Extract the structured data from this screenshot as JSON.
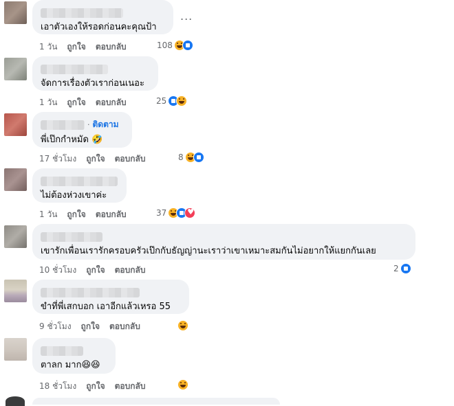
{
  "comments": [
    {
      "text": "เอาตัวเองให้รอดก่อนคะคุณป้า",
      "time": "1 วัน",
      "like_label": "ถูกใจ",
      "reply_label": "ตอบกลับ",
      "reaction_count": "108",
      "reactions": [
        "haha-icon",
        "like-icon"
      ],
      "more": "..."
    },
    {
      "text": "จัดการเรื่องตัวเราก่อนเนอะ",
      "time": "1 วัน",
      "like_label": "ถูกใจ",
      "reply_label": "ตอบกลับ",
      "reaction_count": "25",
      "reactions": [
        "like-icon",
        "haha-icon"
      ]
    },
    {
      "text": "พี่เป๊กกำหมัด 🤣",
      "follow_label": "ติดตาม",
      "time": "17 ชั่วโมง",
      "like_label": "ถูกใจ",
      "reply_label": "ตอบกลับ",
      "reaction_count": "8",
      "reactions": [
        "haha-icon",
        "like-icon"
      ]
    },
    {
      "text": "ไม่ต้องห่วงเขาค่ะ",
      "time": "1 วัน",
      "like_label": "ถูกใจ",
      "reply_label": "ตอบกลับ",
      "reaction_count": "37",
      "reactions": [
        "haha-icon",
        "like-icon",
        "love-icon"
      ]
    },
    {
      "text": "เขารักเพื่อนเรารักครอบครัวเป๊กกับธัญญ่านะเราว่าเขาเหมาะสมกันไม่อยากให้แยกกันเลย",
      "time": "10 ชั่วโมง",
      "like_label": "ถูกใจ",
      "reply_label": "ตอบกลับ",
      "reaction_count": "2",
      "reactions": [
        "like-icon"
      ]
    },
    {
      "text": "ขำที่พี่เสกบอก เอาอีกแล้วเหรอ 55",
      "time": "9 ชั่วโมง",
      "like_label": "ถูกใจ",
      "reply_label": "ตอบกลับ",
      "reactions": [
        "haha-icon"
      ]
    },
    {
      "text": "ตาลก มาก😆😆",
      "time": "18 ชั่วโมง",
      "like_label": "ถูกใจ",
      "reply_label": "ตอบกลับ",
      "reactions": [
        "haha-icon"
      ]
    }
  ],
  "colors": {
    "bubble": "#f0f2f5",
    "meta_text": "#65676b",
    "follow_link": "#1b74e4",
    "like_blue": "#1877f2",
    "haha_yellow": "#f7b125",
    "love_red": "#f33e58"
  }
}
